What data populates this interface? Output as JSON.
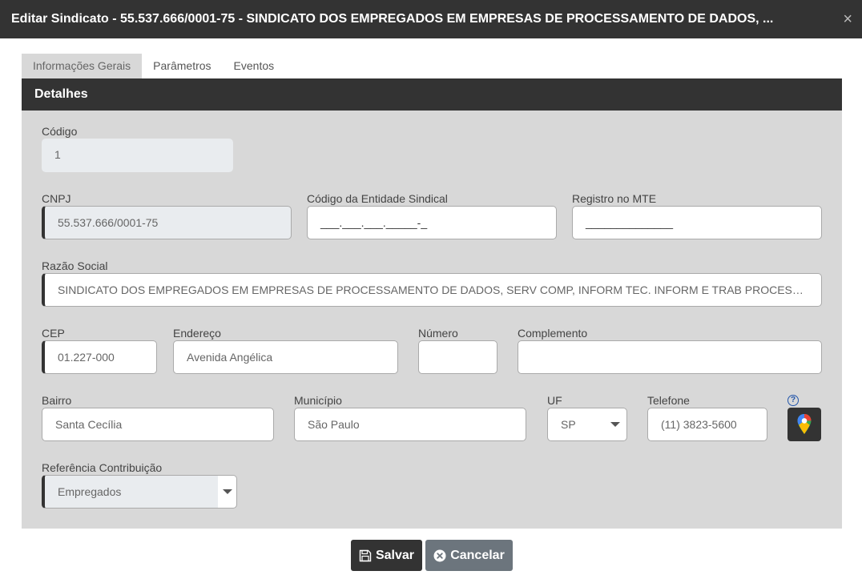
{
  "dialog": {
    "title": "Editar Sindicato - 55.537.666/0001-75 - SINDICATO DOS EMPREGADOS EM EMPRESAS DE PROCESSAMENTO DE DADOS, ...",
    "close_glyph": "×"
  },
  "tabs": [
    {
      "label": "Informações Gerais",
      "active": true
    },
    {
      "label": "Parâmetros",
      "active": false
    },
    {
      "label": "Eventos",
      "active": false
    }
  ],
  "section": {
    "title": "Detalhes"
  },
  "form": {
    "codigo": {
      "label": "Código",
      "value": "1"
    },
    "cnpj": {
      "label": "CNPJ",
      "value": "55.537.666/0001-75"
    },
    "codigo_entidade": {
      "label": "Código da Entidade Sindical",
      "value": "___.___.___._____-_"
    },
    "registro_mte": {
      "label": "Registro no MTE",
      "value": "______________"
    },
    "razao_social": {
      "label": "Razão Social",
      "value": "SINDICATO DOS EMPREGADOS EM EMPRESAS DE PROCESSAMENTO DE DADOS, SERV COMP, INFORM TEC. INFORM E TRAB PROCESSAMENTO DE DADOS"
    },
    "cep": {
      "label": "CEP",
      "value": "01.227-000"
    },
    "endereco": {
      "label": "Endereço",
      "value": "Avenida Angélica"
    },
    "numero": {
      "label": "Número",
      "value": ""
    },
    "complemento": {
      "label": "Complemento",
      "value": ""
    },
    "bairro": {
      "label": "Bairro",
      "value": "Santa Cecília"
    },
    "municipio": {
      "label": "Município",
      "value": "São Paulo"
    },
    "uf": {
      "label": "UF",
      "value": "SP"
    },
    "telefone": {
      "label": "Telefone",
      "value": "(11) 3823-5600"
    },
    "help_glyph": "?",
    "referencia": {
      "label": "Referência Contribuição",
      "value": "Empregados"
    }
  },
  "buttons": {
    "save": "Salvar",
    "cancel": "Cancelar"
  },
  "icons": {
    "save": "floppy-disk-icon",
    "cancel": "x-circle-icon",
    "map": "google-maps-pin-icon"
  }
}
